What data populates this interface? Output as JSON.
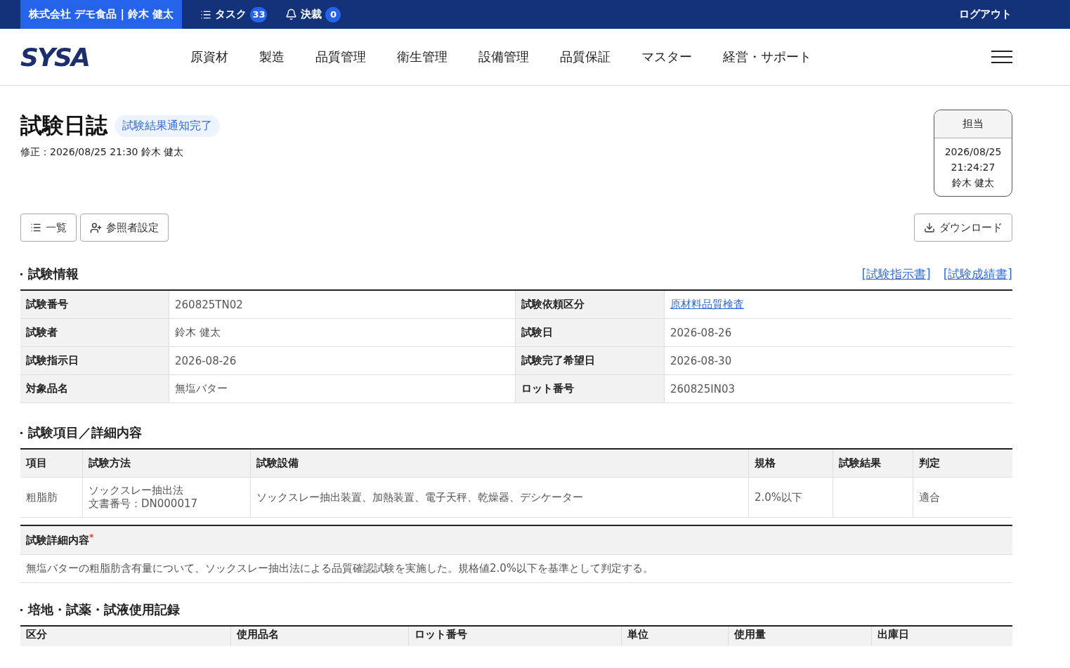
{
  "topbar": {
    "company_user": "株式会社 デモ食品 | 鈴木 健太",
    "tasks": {
      "label": "タスク",
      "count": "33"
    },
    "approvals": {
      "label": "決裁",
      "count": "0"
    },
    "logout": "ログアウト"
  },
  "nav": {
    "logo": "SYSA",
    "items": [
      "原資材",
      "製造",
      "品質管理",
      "衛生管理",
      "設備管理",
      "品質保証",
      "マスター",
      "経営・サポート"
    ]
  },
  "header": {
    "title": "試験日誌",
    "status": "試験結果通知完了",
    "modified": "修正：2026/08/25 21:30  鈴木 健太",
    "approval": {
      "heading": "担当",
      "date": "2026/08/25",
      "time": "21:24:27",
      "name": "鈴木 健太"
    }
  },
  "actions": {
    "left": [
      {
        "kind": "list",
        "label": "一覧"
      },
      {
        "kind": "user",
        "label": "参照者設定"
      }
    ],
    "download": "ダウンロード"
  },
  "test_info": {
    "heading": "試験情報",
    "links": [
      "[試験指示書]",
      "[試験成績書]"
    ],
    "rows": [
      [
        {
          "label": "試験番号",
          "value": "260825TN02"
        },
        {
          "label": "試験依頼区分",
          "value": "原材料品質検査",
          "link": true
        }
      ],
      [
        {
          "label": "試験者",
          "value": "鈴木 健太"
        },
        {
          "label": "試験日",
          "value": "2026-08-26"
        }
      ],
      [
        {
          "label": "試験指示日",
          "value": "2026-08-26"
        },
        {
          "label": "試験完了希望日",
          "value": "2026-08-30"
        }
      ],
      [
        {
          "label": "対象品名",
          "value": "無塩バター"
        },
        {
          "label": "ロット番号",
          "value": "260825IN03"
        }
      ]
    ]
  },
  "test_items": {
    "heading": "試験項目／詳細内容",
    "columns": [
      "項目",
      "試験方法",
      "試験設備",
      "規格",
      "試験結果",
      "判定"
    ],
    "rows": [
      {
        "item": "粗脂肪",
        "method": [
          "ソックスレー抽出法",
          "文書番号：DN000017"
        ],
        "equipment": "ソックスレー抽出装置、加熱装置、電子天秤、乾燥器、デシケーター",
        "spec": "2.0%以下",
        "judgement": "適合"
      }
    ],
    "detail": {
      "label": "試験詳細内容",
      "required_mark": "*",
      "text": "無塩バターの粗脂肪含有量について、ソックスレー抽出法による品質確認試験を実施した。規格値2.0%以下を基準として判定する。"
    }
  },
  "usage_record": {
    "heading": "培地・試薬・試液使用記録",
    "columns": [
      "区分",
      "使用品名",
      "ロット番号",
      "単位",
      "使用量",
      "出庫日"
    ]
  }
}
